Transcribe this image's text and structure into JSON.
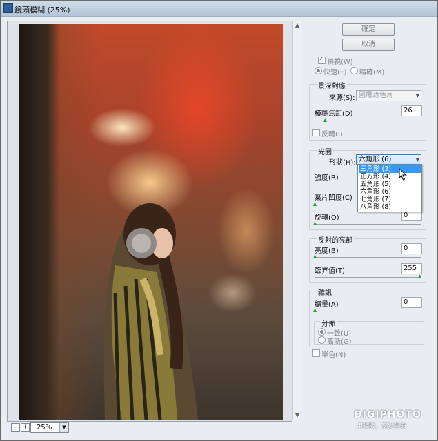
{
  "window": {
    "title": "鏡頭模糊 (25%)"
  },
  "zoom": {
    "value": "25%",
    "minus": "-",
    "plus": "+"
  },
  "buttons": {
    "ok": "確定",
    "cancel": "取消"
  },
  "preview": {
    "label": "預視(W)",
    "checked": true,
    "fast": "快速(F)",
    "accurate": "精確(M)"
  },
  "depth_map": {
    "title": "景深對應",
    "source_label": "來源(S):",
    "source_value": "圖層遮色片",
    "focal_label": "模糊焦距(D)",
    "focal_value": "26",
    "invert_label": "反轉(I)"
  },
  "iris": {
    "title": "光圈",
    "shape_label": "形狀(H):",
    "shape_value": "六角形 (6)",
    "shape_options": [
      "三角形 (3)",
      "正方形 (4)",
      "五角形 (5)",
      "六角形 (6)",
      "七角形 (7)",
      "八角形 (8)"
    ],
    "highlighted_option": "三角形 (3)",
    "radius_label": "強度(R)",
    "curvature_label": "葉片凹度(C)",
    "rotation_label": "旋轉(O)",
    "rotation_value": "0"
  },
  "specular": {
    "title": "反射的亮部",
    "brightness_label": "亮度(B)",
    "brightness_value": "0",
    "threshold_label": "臨界值(T)",
    "threshold_value": "255"
  },
  "noise": {
    "title": "雜訊",
    "amount_label": "總量(A)",
    "amount_value": "0",
    "distribution_title": "分佈",
    "uniform_label": "一致(U)",
    "gaussian_label": "高斯(G)",
    "mono_label": "單色(N)"
  },
  "watermark": {
    "brand": "DIGIPHOTO",
    "tagline": "用相機．享受生命"
  },
  "sliders": {
    "focal": 0.1,
    "radius": 1.0,
    "curvature": 0,
    "rotation": 0,
    "brightness": 0,
    "threshold": 1.0,
    "amount": 0
  }
}
